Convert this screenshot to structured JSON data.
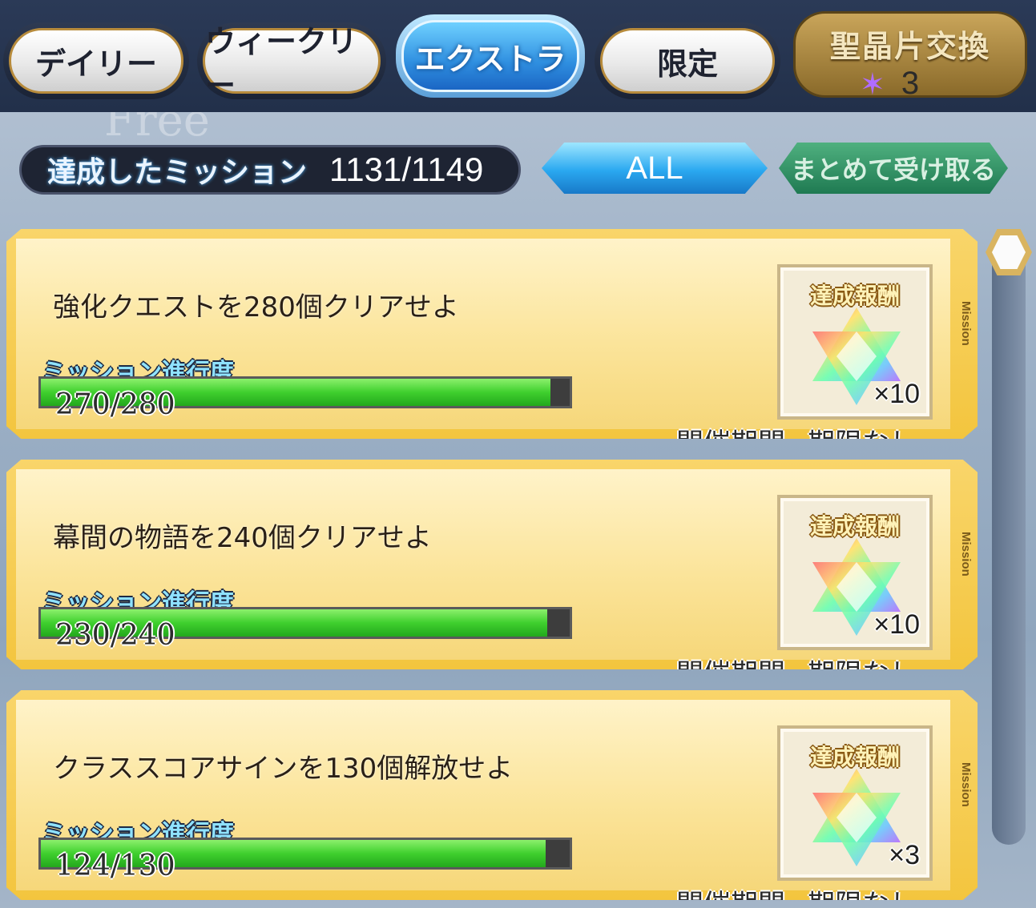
{
  "tabs": [
    {
      "label": "デイリー",
      "active": false
    },
    {
      "label": "ウィークリー",
      "active": false
    },
    {
      "label": "エクストラ",
      "active": true
    },
    {
      "label": "限定",
      "active": false
    }
  ],
  "exchange": {
    "label": "聖晶片交換",
    "count": "3",
    "icon": "saint-quartz-fragment-icon"
  },
  "summary": {
    "label": "達成したミッション",
    "value": "1131/1149"
  },
  "filter_button": "ALL",
  "receive_all_button": "まとめて受け取る",
  "missions": [
    {
      "title": "強化クエストを280個クリアせよ",
      "progress_label": "ミッション進行度",
      "progress_text": "270/280",
      "progress_fraction": 0.964,
      "reward_label": "達成報酬",
      "reward_qty": "×10",
      "period_label": "開催期間",
      "period_value": "期限なし",
      "side_label": "Mission"
    },
    {
      "title": "幕間の物語を240個クリアせよ",
      "progress_label": "ミッション進行度",
      "progress_text": "230/240",
      "progress_fraction": 0.958,
      "reward_label": "達成報酬",
      "reward_qty": "×10",
      "period_label": "開催期間",
      "period_value": "期限なし",
      "side_label": "Mission"
    },
    {
      "title": "クラススコアサインを130個解放せよ",
      "progress_label": "ミッション進行度",
      "progress_text": "124/130",
      "progress_fraction": 0.954,
      "reward_label": "達成報酬",
      "reward_qty": "×3",
      "period_label": "開催期間",
      "period_value": "期限なし",
      "side_label": "Mission"
    }
  ],
  "colors": {
    "card_gold": "#f3c53e",
    "progress_green": "#3fcf2e",
    "active_tab_blue": "#2f8fe0",
    "receive_green": "#1f7a52"
  }
}
